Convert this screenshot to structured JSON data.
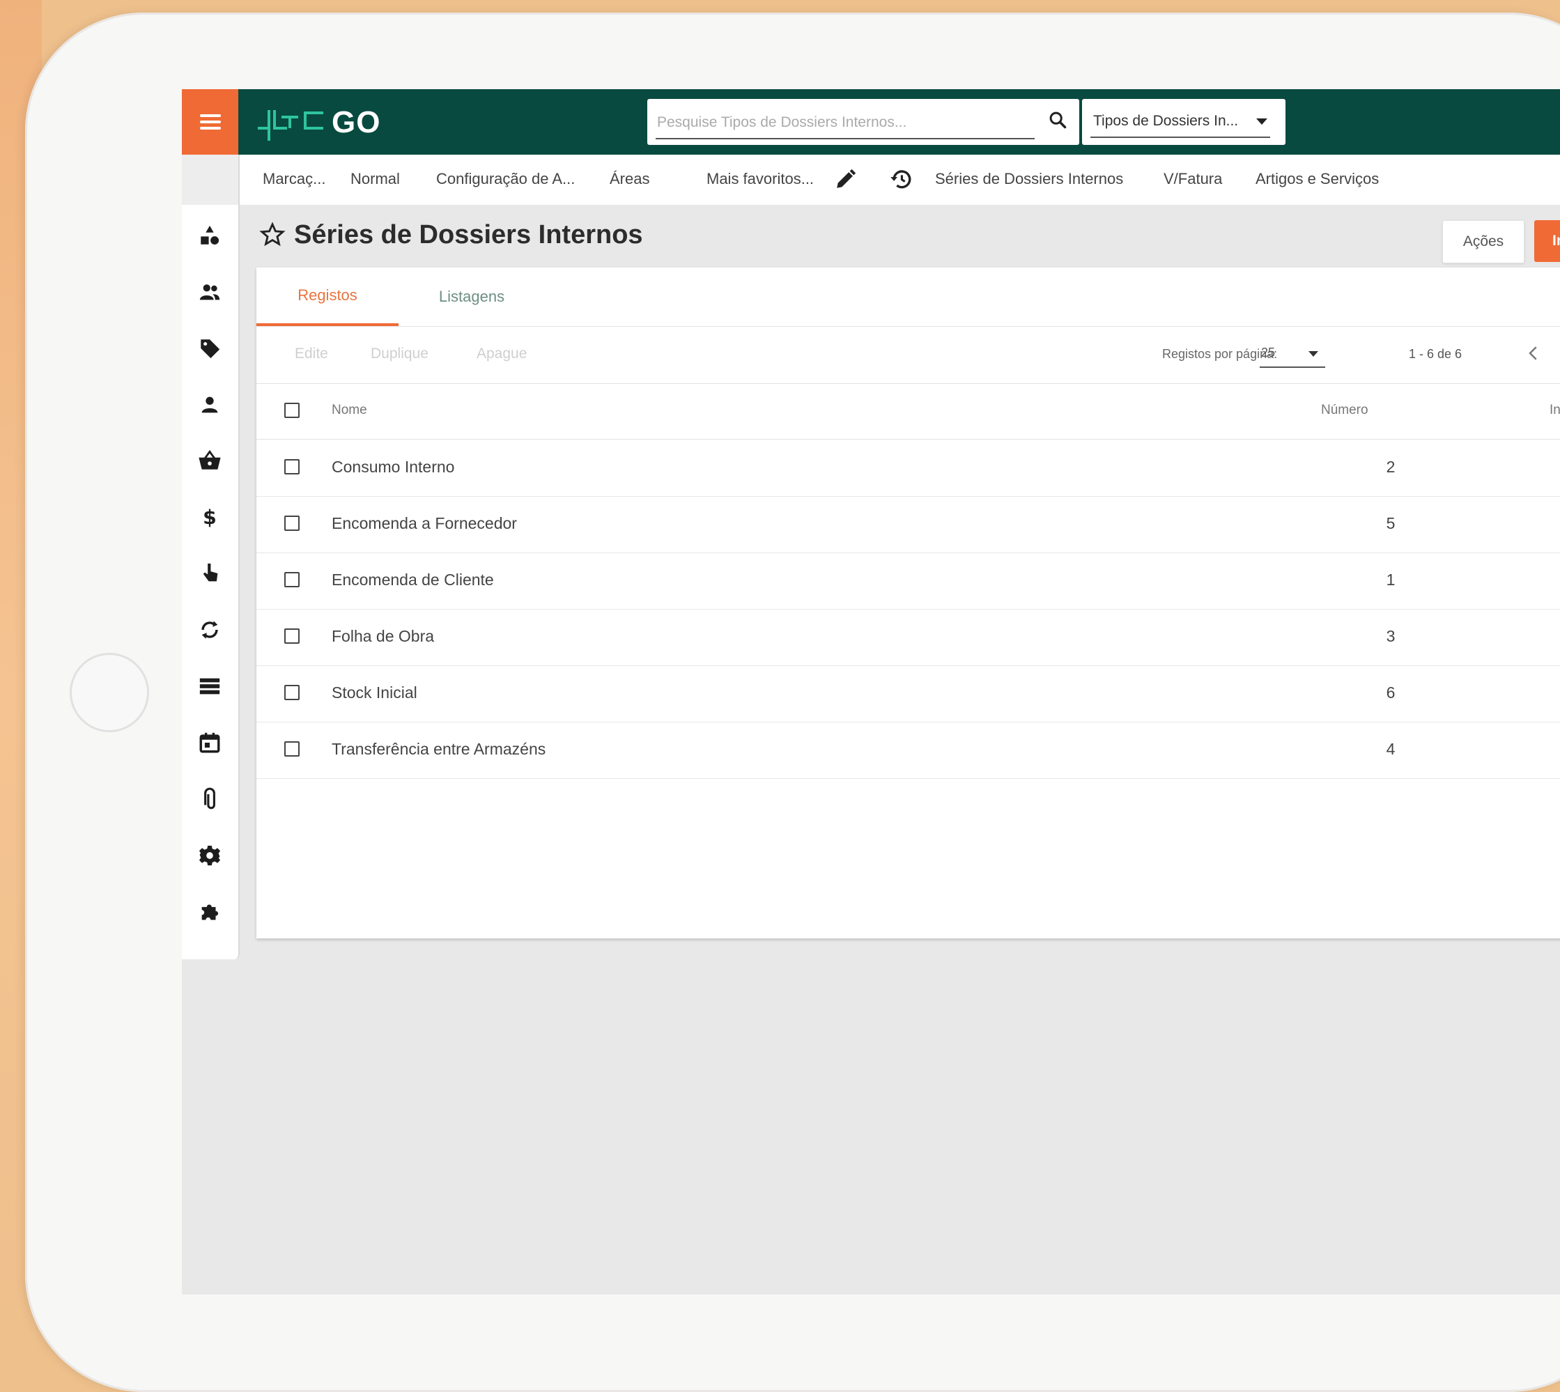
{
  "app": {
    "logo_text": "GO",
    "brand_color": "#084a3f",
    "accent_color": "#f06a35"
  },
  "search": {
    "placeholder": "Pesquise Tipos de Dossiers Internos...",
    "value": "",
    "type_selected": "Tipos de Dossiers In..."
  },
  "favorites": {
    "items": [
      "Marcaç...",
      "Normal",
      "Configuração de A...",
      "Áreas",
      "Mais favoritos..."
    ],
    "recent": [
      "Séries de Dossiers Internos",
      "V/Fatura",
      "Artigos e Serviços"
    ]
  },
  "sidebar": {
    "icons": [
      "shapes-icon",
      "people-icon",
      "tag-icon",
      "person-icon",
      "basket-icon",
      "dollar-icon",
      "touch-icon",
      "sync-icon",
      "list-icon",
      "calendar-icon",
      "attachment-icon",
      "settings-icon",
      "puzzle-icon"
    ]
  },
  "page": {
    "title": "Séries de Dossiers Internos",
    "actions_label": "Ações",
    "introduce_label": "Introduzir"
  },
  "tabs": [
    {
      "label": "Registos",
      "active": true
    },
    {
      "label": "Listagens",
      "active": false
    }
  ],
  "toolbar": {
    "edit_label": "Edite",
    "duplicate_label": "Duplique",
    "delete_label": "Apague",
    "per_page_label": "Registos por página:",
    "per_page_value": "25",
    "pager_text": "1 - 6 de 6"
  },
  "table": {
    "columns": {
      "nome": "Nome",
      "numero": "Número",
      "extra": "In"
    },
    "rows": [
      {
        "nome": "Consumo Interno",
        "numero": "2"
      },
      {
        "nome": "Encomenda a Fornecedor",
        "numero": "5"
      },
      {
        "nome": "Encomenda de Cliente",
        "numero": "1"
      },
      {
        "nome": "Folha de Obra",
        "numero": "3"
      },
      {
        "nome": "Stock Inicial",
        "numero": "6"
      },
      {
        "nome": "Transferência entre Armazéns",
        "numero": "4"
      }
    ]
  }
}
